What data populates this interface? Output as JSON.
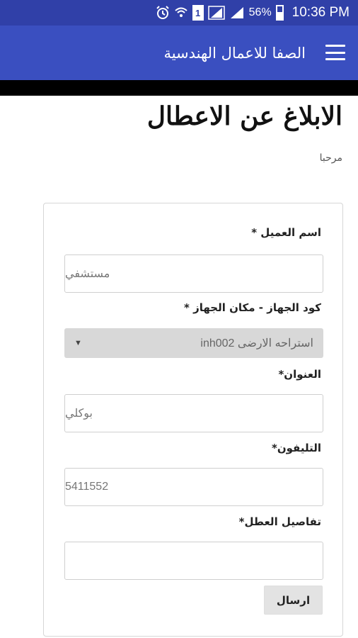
{
  "status_bar": {
    "icons": [
      "alarm-icon",
      "wifi-icon",
      "sim-1-icon",
      "signal-icon",
      "signal-icon"
    ],
    "sim_label": "1",
    "battery_percent": "56%",
    "time": "10:36 PM"
  },
  "app_bar": {
    "title": "الصفا للاعمال الهندسية",
    "menu_icon": "hamburger-menu-icon",
    "background_color": "#3a4fc0"
  },
  "page": {
    "title": "الابلاغ عن الاعطال",
    "welcome": "مرحبا"
  },
  "form": {
    "customer_label": "اسم العميل *",
    "customer_value": "مستشفي",
    "device_label": "كود الجهاز - مكان الجهاز *",
    "device_value": "inh002 استراحه الارضى",
    "address_label": "العنوان*",
    "address_value": "بوكلي",
    "phone_label": "التليفون*",
    "phone_value": "5411552",
    "details_label": "تفاصيل العطل*",
    "details_value": "",
    "submit_label": "ارسال"
  }
}
